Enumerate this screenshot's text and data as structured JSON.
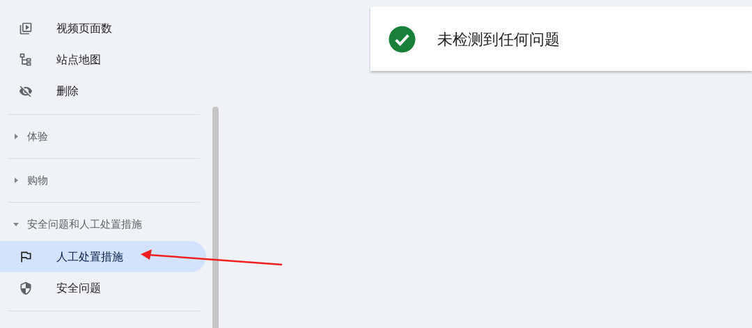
{
  "sidebar": {
    "items": [
      {
        "kind": "video",
        "label": "视频页面数",
        "selected": false
      },
      {
        "kind": "sitemap",
        "label": "站点地图",
        "selected": false
      },
      {
        "kind": "hidden",
        "label": "删除",
        "selected": false
      },
      {
        "kind": "section",
        "label": "体验",
        "expanded": false
      },
      {
        "kind": "section",
        "label": "购物",
        "expanded": false
      },
      {
        "kind": "section",
        "label": "安全问题和人工处置措施",
        "expanded": true,
        "children": [
          {
            "kind": "flag",
            "label": "人工处置措施",
            "selected": true
          },
          {
            "kind": "shield",
            "label": "安全问题",
            "selected": false
          }
        ]
      }
    ]
  },
  "status_card": {
    "message": "未检测到任何问题"
  }
}
